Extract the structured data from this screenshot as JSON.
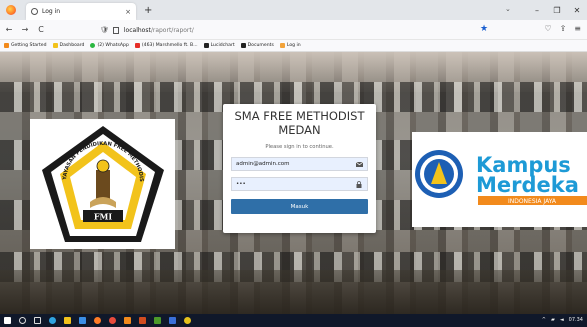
{
  "browser": {
    "tab_title": "Log in",
    "tab_close": "×",
    "new_tab": "+",
    "url_host": "localhost",
    "url_path": "/raport/raport/",
    "back": "←",
    "forward": "→",
    "reload": "C",
    "bookmark_star": "★",
    "window_controls": [
      "⌄",
      "–",
      "❐",
      "✕"
    ],
    "toolbar_icons": [
      "♡",
      "⇪",
      "≡"
    ],
    "bookmarks": [
      {
        "label": "Getting Started",
        "color": "#f28a1c"
      },
      {
        "label": "Dashboard",
        "color": "#f2c21c"
      },
      {
        "label": "(2) WhatsApp",
        "color": "#2bb741"
      },
      {
        "label": "(463) Marshmello ft. B...",
        "color": "#e52d27"
      },
      {
        "label": "Lucidchart",
        "color": "#222222"
      },
      {
        "label": "Documents",
        "color": "#222222"
      },
      {
        "label": "Log in",
        "color": "#f2a33a"
      }
    ]
  },
  "login": {
    "title": "SMA FREE METHODIST MEDAN",
    "subtitle": "Please sign in to continue.",
    "email_value": "admin@admin.com",
    "password_value": "•••",
    "submit_label": "Masuk",
    "accent_color": "#2f6fa8"
  },
  "logos": {
    "fmi_ring_text": "YAYASAN PENDIDIKAN FREE METHODIST INDONESIA",
    "fmi_letters": "FMI",
    "kampus_line1": "Kampus",
    "kampus_line2": "Merdeka",
    "kampus_tagline": "INDONESIA JAYA"
  },
  "taskbar": {
    "time": "07.34"
  }
}
